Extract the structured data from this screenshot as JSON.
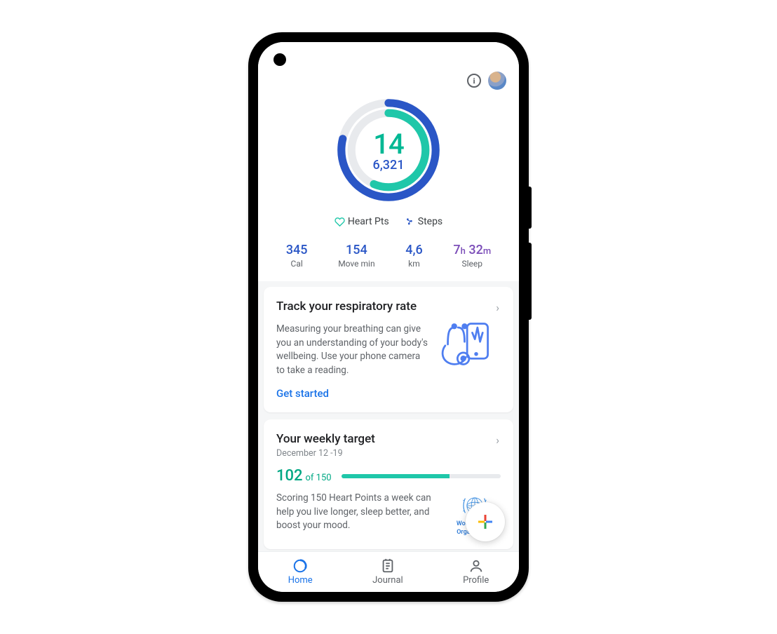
{
  "ring": {
    "heart_points": "14",
    "steps": "6,321"
  },
  "legend": {
    "heart_pts": "Heart Pts",
    "steps": "Steps"
  },
  "stats": {
    "cal": {
      "value": "345",
      "label": "Cal"
    },
    "move": {
      "value": "154",
      "label": "Move min"
    },
    "km": {
      "value": "4,6",
      "label": "km"
    },
    "sleep": {
      "h": "7",
      "h_unit": "h",
      "m": "32",
      "m_unit": "m",
      "label": "Sleep"
    }
  },
  "card_resp": {
    "title": "Track your respiratory rate",
    "body": "Measuring your breathing can give you an understanding of your body's wellbeing. Use your phone camera to take a reading.",
    "action": "Get started"
  },
  "card_target": {
    "title": "Your weekly target",
    "subtitle": "December 12 -19",
    "value": "102",
    "of_label": "of 150",
    "body": "Scoring 150 Heart Points a week can help you live longer, sleep better, and boost your mood.",
    "who_line1": "World Health",
    "who_line2": "Organization"
  },
  "nav": {
    "home": "Home",
    "journal": "Journal",
    "profile": "Profile"
  }
}
